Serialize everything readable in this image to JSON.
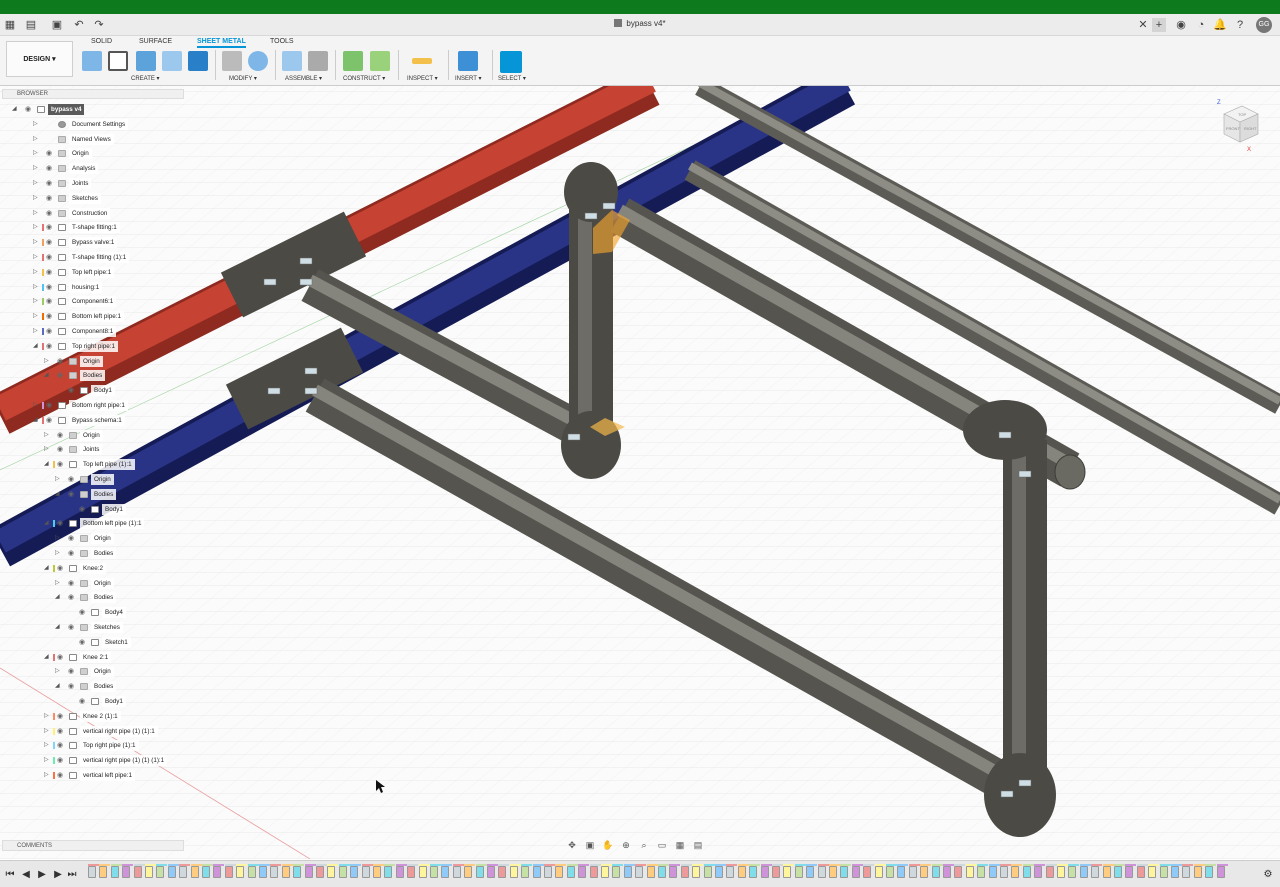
{
  "window": {
    "title": "bypass v4*",
    "user_initials": "GG"
  },
  "toolbar": {
    "workspace": "DESIGN ▾",
    "tabs": [
      "SOLID",
      "SURFACE",
      "SHEET METAL",
      "TOOLS"
    ],
    "active_tab": "SHEET METAL",
    "groups": [
      "CREATE ▾",
      "MODIFY ▾",
      "ASSEMBLE ▾",
      "CONSTRUCT ▾",
      "INSPECT ▾",
      "INSERT ▾",
      "SELECT ▾"
    ]
  },
  "browser": {
    "header": "BROWSER",
    "items": [
      {
        "label": "bypass v4",
        "depth": 0,
        "expand": "open",
        "type": "root",
        "selected": true
      },
      {
        "label": "Document Settings",
        "depth": 1,
        "expand": "closed",
        "type": "gear"
      },
      {
        "label": "Named Views",
        "depth": 1,
        "expand": "closed",
        "type": "folder"
      },
      {
        "label": "Origin",
        "depth": 1,
        "expand": "closed",
        "type": "folder"
      },
      {
        "label": "Analysis",
        "depth": 1,
        "expand": "closed",
        "type": "folder"
      },
      {
        "label": "Joints",
        "depth": 1,
        "expand": "closed",
        "type": "folder"
      },
      {
        "label": "Sketches",
        "depth": 1,
        "expand": "closed",
        "type": "folder"
      },
      {
        "label": "Construction",
        "depth": 1,
        "expand": "closed",
        "type": "folder"
      },
      {
        "label": "T-shape fitting:1",
        "depth": 1,
        "expand": "closed",
        "type": "comp",
        "color": "#e57373"
      },
      {
        "label": "Bypass valve:1",
        "depth": 1,
        "expand": "closed",
        "type": "comp",
        "color": "#f0a060"
      },
      {
        "label": "T-shape fitting (1):1",
        "depth": 1,
        "expand": "closed",
        "type": "comp",
        "color": "#e57373"
      },
      {
        "label": "Top left pipe:1",
        "depth": 1,
        "expand": "closed",
        "type": "comp",
        "color": "#f3c14b"
      },
      {
        "label": "housing:1",
        "depth": 1,
        "expand": "closed",
        "type": "comp",
        "color": "#4fc3f7"
      },
      {
        "label": "Component6:1",
        "depth": 1,
        "expand": "closed",
        "type": "comp",
        "color": "#9ccc65"
      },
      {
        "label": "Bottom left pipe:1",
        "depth": 1,
        "expand": "closed",
        "type": "comp",
        "color": "#ef6c00"
      },
      {
        "label": "Component8:1",
        "depth": 1,
        "expand": "closed",
        "type": "comp",
        "color": "#5c6bc0"
      },
      {
        "label": "Top right pipe:1",
        "depth": 1,
        "expand": "open",
        "type": "comp",
        "color": "#e57373"
      },
      {
        "label": "Origin",
        "depth": 2,
        "expand": "closed",
        "type": "folder"
      },
      {
        "label": "Bodies",
        "depth": 2,
        "expand": "open",
        "type": "folder"
      },
      {
        "label": "Body1",
        "depth": 3,
        "expand": "none",
        "type": "body"
      },
      {
        "label": "Bottom right pipe:1",
        "depth": 1,
        "expand": "closed",
        "type": "comp",
        "color": "#ce93d8"
      },
      {
        "label": "Bypass schema:1",
        "depth": 1,
        "expand": "open",
        "type": "comp",
        "color": "#e57373"
      },
      {
        "label": "Origin",
        "depth": 2,
        "expand": "closed",
        "type": "folder"
      },
      {
        "label": "Joints",
        "depth": 2,
        "expand": "closed",
        "type": "folder"
      },
      {
        "label": "Top left pipe (1):1",
        "depth": 2,
        "expand": "open",
        "type": "comp",
        "color": "#f3c14b"
      },
      {
        "label": "Origin",
        "depth": 3,
        "expand": "closed",
        "type": "folder"
      },
      {
        "label": "Bodies",
        "depth": 3,
        "expand": "open",
        "type": "folder"
      },
      {
        "label": "Body1",
        "depth": 4,
        "expand": "none",
        "type": "body"
      },
      {
        "label": "Bottom left pipe (1):1",
        "depth": 2,
        "expand": "open",
        "type": "comp",
        "color": "#4dd0e1"
      },
      {
        "label": "Origin",
        "depth": 3,
        "expand": "closed",
        "type": "folder"
      },
      {
        "label": "Bodies",
        "depth": 3,
        "expand": "closed",
        "type": "folder"
      },
      {
        "label": "Knee:2",
        "depth": 2,
        "expand": "open",
        "type": "comp",
        "color": "#c0ca33"
      },
      {
        "label": "Origin",
        "depth": 3,
        "expand": "closed",
        "type": "folder"
      },
      {
        "label": "Bodies",
        "depth": 3,
        "expand": "open",
        "type": "folder"
      },
      {
        "label": "Body4",
        "depth": 4,
        "expand": "none",
        "type": "body"
      },
      {
        "label": "Sketches",
        "depth": 3,
        "expand": "open",
        "type": "folder"
      },
      {
        "label": "Sketch1",
        "depth": 4,
        "expand": "none",
        "type": "sketch"
      },
      {
        "label": "Knee 2:1",
        "depth": 2,
        "expand": "open",
        "type": "comp",
        "color": "#e57373"
      },
      {
        "label": "Origin",
        "depth": 3,
        "expand": "closed",
        "type": "folder"
      },
      {
        "label": "Bodies",
        "depth": 3,
        "expand": "open",
        "type": "folder"
      },
      {
        "label": "Body1",
        "depth": 4,
        "expand": "none",
        "type": "body"
      },
      {
        "label": "Knee 2 (1):1",
        "depth": 2,
        "expand": "closed",
        "type": "comp",
        "color": "#ff8a65"
      },
      {
        "label": "vertical right pipe (1) (1):1",
        "depth": 2,
        "expand": "closed",
        "type": "comp",
        "color": "#fff176"
      },
      {
        "label": "Top right pipe (1):1",
        "depth": 2,
        "expand": "closed",
        "type": "comp",
        "color": "#81d4fa"
      },
      {
        "label": "vertical right pipe (1) (1) (1):1",
        "depth": 2,
        "expand": "closed",
        "type": "comp",
        "color": "#69f0ae"
      },
      {
        "label": "vertical left pipe:1",
        "depth": 2,
        "expand": "closed",
        "type": "comp",
        "color": "#ff7043"
      }
    ]
  },
  "comments": {
    "header": "COMMENTS"
  },
  "colors": {
    "accent": "#0696d7",
    "title_strip": "#0d7a1e",
    "pipe_red": "#c0392b",
    "pipe_blue": "#1f2a78",
    "pipe_grey": "#6b6a62"
  },
  "viewcube": {
    "face_top": "TOP",
    "face_front": "FRONT",
    "face_right": "RIGHT",
    "axis_z": "Z",
    "axis_x": "X"
  }
}
